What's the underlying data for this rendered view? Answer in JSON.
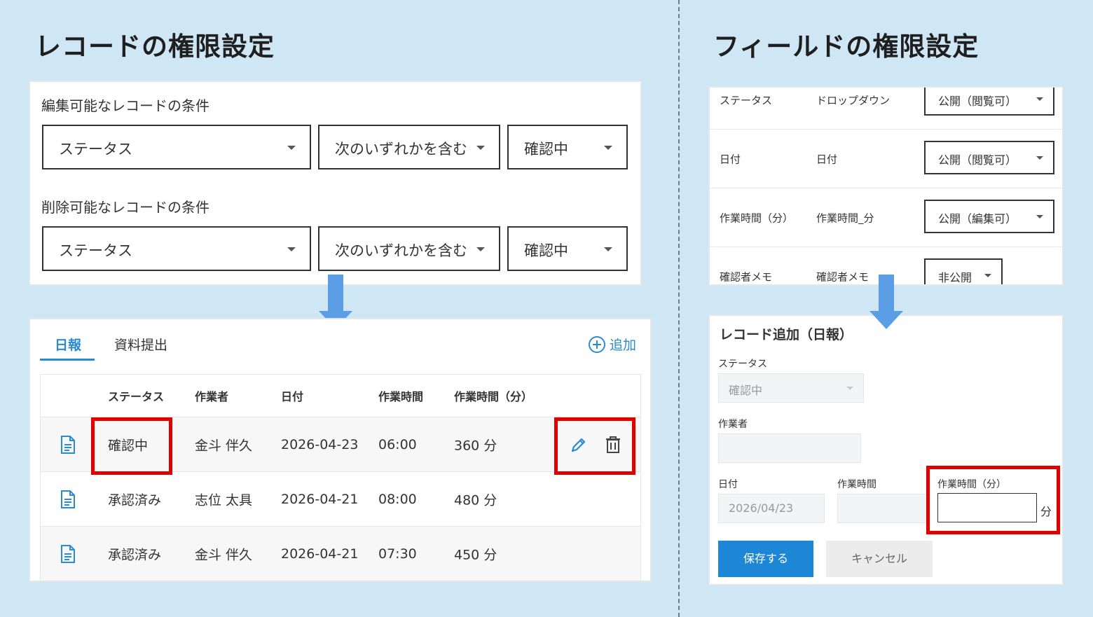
{
  "left_title": "レコードの権限設定",
  "right_title": "フィールドの権限設定",
  "conditions": {
    "edit_label": "編集可能なレコードの条件",
    "delete_label": "削除可能なレコードの条件",
    "edit": {
      "field": "ステータス",
      "operator": "次のいずれかを含む",
      "value": "確認中"
    },
    "delete": {
      "field": "ステータス",
      "operator": "次のいずれかを含む",
      "value": "確認中"
    }
  },
  "list": {
    "tabs": [
      "日報",
      "資料提出"
    ],
    "add_label": "追加",
    "headers": [
      "ステータス",
      "作業者",
      "日付",
      "作業時間",
      "作業時間（分）"
    ],
    "rows": [
      [
        "確認中",
        "金斗 伴久",
        "2026-04-23",
        "06:00",
        "360 分"
      ],
      [
        "承認済み",
        "志位 太具",
        "2026-04-21",
        "08:00",
        "480 分"
      ],
      [
        "承認済み",
        "金斗 伴久",
        "2026-04-21",
        "07:30",
        "450 分"
      ]
    ]
  },
  "fields": [
    {
      "name": "ステータス",
      "type": "ドロップダウン",
      "permission": "公開（閲覧可）"
    },
    {
      "name": "日付",
      "type": "日付",
      "permission": "公開（閲覧可）"
    },
    {
      "name": "作業時間（分）",
      "type": "作業時間_分",
      "permission": "公開（編集可）"
    },
    {
      "name": "確認者メモ",
      "type": "確認者メモ",
      "permission": "非公開"
    }
  ],
  "form": {
    "title": "レコード追加（日報）",
    "status_label": "ステータス",
    "status_value": "確認中",
    "worker_label": "作業者",
    "date_label": "日付",
    "date_value": "2026/04/23",
    "time_label": "作業時間",
    "minutes_label": "作業時間（分）",
    "minutes_unit": "分",
    "save_label": "保存する",
    "cancel_label": "キャンセル"
  },
  "colors": {
    "highlight": "#e00000",
    "accent": "#2b8bd0",
    "arrow": "#5b9ee6",
    "background": "#cfe6f5"
  }
}
